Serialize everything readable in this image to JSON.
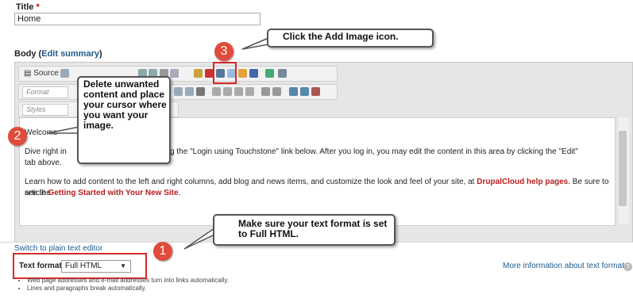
{
  "title_field": {
    "label": "Title",
    "required_mark": "*",
    "value": "Home"
  },
  "body_field": {
    "label": "Body",
    "edit_summary_link": "Edit summary"
  },
  "toolbar": {
    "source_label": "Source",
    "format_combo": "Format",
    "styles_combo": "Styles",
    "add_image_icon": "image-icon"
  },
  "content": {
    "welcome": "Welcome",
    "p1_start": "Dive right in",
    "p1_rest": "g in by clicking the \"Login using Touchstone\" link below. After you log in, you may edit the content in this area by clicking the \"Edit\"",
    "p1_line2": "tab above.",
    "p2_start": "Learn how to add content to the left and right columns, add blog and news items, and customize the look and feel of your site, at ",
    "p2_link": "DrupalCloud help pages",
    "p2_end": ". Be sure to see the",
    "p3_start": "article ",
    "p3_link": "Getting Started with Your New Site",
    "p3_end": "."
  },
  "switch_link": "Switch to plain text editor",
  "text_format": {
    "label": "Text format",
    "selected": "Full HTML",
    "more_info": "More information about text formats"
  },
  "tips": [
    "Web page addresses and e-mail addresses turn into links automatically.",
    "Lines and paragraphs break automatically."
  ],
  "callouts": {
    "c1_number": "1",
    "c1_text": "Make sure your text format is set to Full HTML.",
    "c2_number": "2",
    "c2_text": "Delete unwanted content and place your cursor where you want your image.",
    "c3_number": "3",
    "c3_text": "Click the Add Image icon."
  },
  "colors": {
    "callout_badge": "#e04b3c",
    "highlight_box": "#d72a2a",
    "link": "#1d5a8e"
  }
}
